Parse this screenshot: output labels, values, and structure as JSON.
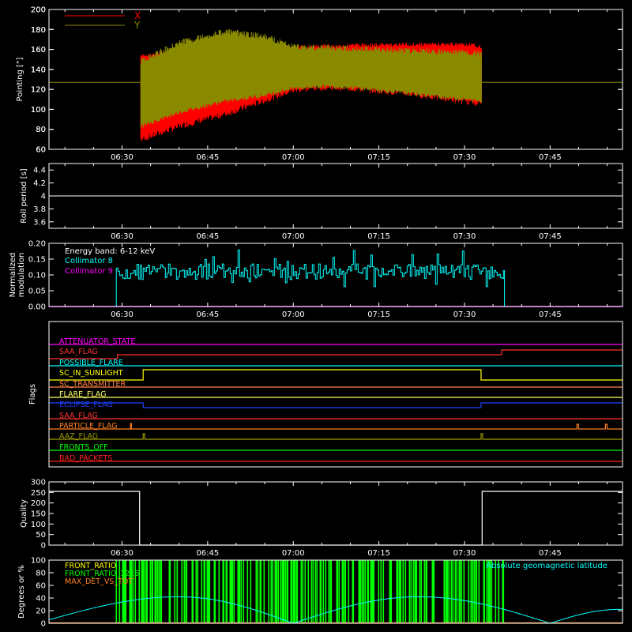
{
  "chart_data": [
    {
      "type": "line",
      "panel": "pointing",
      "ylabel": "Pointing [\"]",
      "ylim": [
        60,
        200
      ],
      "yticks": [
        60,
        80,
        100,
        120,
        140,
        160,
        180,
        200
      ],
      "xticks": [
        "06:30",
        "06:45",
        "07:00",
        "07:15",
        "07:30",
        "07:45"
      ],
      "legend": [
        {
          "name": "X",
          "color": "#ff0000"
        },
        {
          "name": "Y",
          "color": "#8a8a00"
        }
      ],
      "series": [
        {
          "name": "Y",
          "color": "#8a8a00",
          "x": [
            "06:33",
            "06:40",
            "06:48",
            "06:55",
            "07:00",
            "07:05",
            "07:10",
            "07:20",
            "07:30",
            "07:33"
          ],
          "upper": [
            150,
            170,
            181,
            176,
            166,
            165,
            164,
            162,
            160,
            158
          ],
          "lower": [
            80,
            95,
            106,
            112,
            119,
            121,
            120,
            114,
            108,
            106
          ],
          "baseline": 127
        },
        {
          "name": "X",
          "color": "#ff0000",
          "x": [
            "06:33",
            "06:40",
            "06:48",
            "06:55",
            "07:00",
            "07:05",
            "07:10",
            "07:20",
            "07:30",
            "07:33"
          ],
          "upper": [
            155,
            160,
            163,
            164,
            164,
            165,
            166,
            167,
            167,
            165
          ],
          "lower": [
            66,
            80,
            92,
            106,
            116,
            119,
            118,
            113,
            105,
            103
          ]
        }
      ]
    },
    {
      "type": "line",
      "panel": "roll-period",
      "ylabel": "Roll period [s]",
      "ylim": [
        3.5,
        4.5
      ],
      "yticks": [
        3.6,
        3.8,
        4.0,
        4.2,
        4.4
      ],
      "xticks": [
        "06:30",
        "06:45",
        "07:00",
        "07:15",
        "07:30",
        "07:45"
      ],
      "series": [
        {
          "name": "",
          "color": "#ffffff",
          "values": [
            4.0,
            4.0
          ]
        }
      ]
    },
    {
      "type": "line",
      "panel": "modulation",
      "ylabel": "Normalized modulation",
      "ylim": [
        0,
        0.2
      ],
      "yticks": [
        "0.00",
        "0.05",
        "0.10",
        "0.15",
        "0.20"
      ],
      "xticks": [
        "06:30",
        "06:45",
        "07:00",
        "07:15",
        "07:30",
        "07:45"
      ],
      "annotation": "Energy band: 6-12 keV",
      "legend": [
        {
          "name": "Collimator 8",
          "color": "#00ffff"
        },
        {
          "name": "Collimator 9",
          "color": "#ff00ff"
        }
      ],
      "series": [
        {
          "name": "Collimator 8",
          "color": "#00ffff",
          "start": "06:29",
          "end": "07:37",
          "mean": 0.11,
          "min": 0.06,
          "max": 0.18
        },
        {
          "name": "Collimator 9",
          "color": "#ff00ff",
          "value": 0.0
        }
      ]
    },
    {
      "type": "line",
      "panel": "flags",
      "ylabel": "Flags",
      "flags": [
        {
          "name": "ATTENUATOR_STATE",
          "color": "#ff00ff"
        },
        {
          "name": "SAA_FLAG",
          "color": "#ff3030"
        },
        {
          "name": "POSSIBLE_FLARE",
          "color": "#00ffff"
        },
        {
          "name": "SC_IN_SUNLIGHT",
          "color": "#ffff00"
        },
        {
          "name": "SC_TRANSMITTER",
          "color": "#ff8040"
        },
        {
          "name": "FLARE_FLAG",
          "color": "#ffff60"
        },
        {
          "name": "ECLIPSE_FLAG",
          "color": "#2040ff"
        },
        {
          "name": "SAA_FLAG",
          "color": "#ff3030"
        },
        {
          "name": "PARTICLE_FLAG",
          "color": "#ff8020"
        },
        {
          "name": "AAZ_FLAG",
          "color": "#9a9a00"
        },
        {
          "name": "FRONTS_OFF",
          "color": "#00ff00"
        },
        {
          "name": "BAD_PACKETS",
          "color": "#ff2020"
        }
      ]
    },
    {
      "type": "line",
      "panel": "quality",
      "ylabel": "Quality",
      "ylim": [
        0,
        300
      ],
      "yticks": [
        0,
        50,
        100,
        150,
        200,
        250,
        300
      ],
      "xticks": [
        "06:30",
        "06:45",
        "07:00",
        "07:15",
        "07:30",
        "07:45"
      ],
      "series": [
        {
          "name": "",
          "color": "#ffffff",
          "x": [
            "start",
            "06:33",
            "06:33",
            "07:33",
            "07:33",
            "end"
          ],
          "values": [
            255,
            255,
            0,
            0,
            255,
            255
          ]
        }
      ]
    },
    {
      "type": "line",
      "panel": "geomagnetic",
      "ylabel": "Degrees or %",
      "ylim": [
        0,
        100
      ],
      "yticks": [
        0,
        20,
        40,
        60,
        80,
        100
      ],
      "legend": [
        {
          "name": "FRONT_RATIO",
          "color": "#ffff00"
        },
        {
          "name": "FRONT_RATIO_1225",
          "color": "#00ff00"
        },
        {
          "name": "MAX_DET_VS_TOT",
          "color": "#ff8020"
        }
      ],
      "annotation": "Absolute geomagnetic latitude",
      "series": [
        {
          "name": "Absolute geomagnetic latitude",
          "color": "#00ffff",
          "x": [
            "06:17",
            "06:40",
            "07:00",
            "07:22",
            "07:45",
            "07:57"
          ],
          "values": [
            5,
            42,
            0,
            42,
            0,
            22
          ]
        },
        {
          "name": "FRONT_RATIO_1225",
          "color": "#00ff00",
          "start": "06:29",
          "end": "07:37",
          "range": [
            0,
            100
          ]
        }
      ]
    }
  ]
}
